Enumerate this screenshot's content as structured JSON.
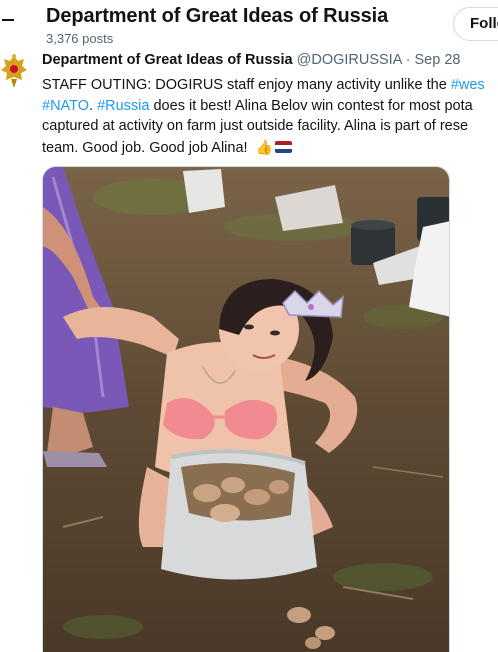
{
  "header": {
    "back_icon": "back-arrow-icon",
    "profile_name": "Department of Great Ideas of Russia",
    "post_count": "3,376 posts",
    "follow_label": "Follo"
  },
  "tweet": {
    "author": "Department of Great Ideas of Russia",
    "handle": "@DOGIRUSSIA",
    "separator": "·",
    "date": "Sep 28",
    "text": {
      "line1_prefix": "STAFF OUTING: DOGIRUS staff enjoy many activity unlike the ",
      "line1_hashtag": "#wes",
      "line2_hashtag1": "#NATO",
      "line2_mid": ". ",
      "line2_hashtag2": "#Russia",
      "line2_suffix": " does it best! Alina Belov win contest for most pota",
      "line3": "captured at activity on farm just outside facility. Alina is part of rese",
      "line4": "team. Good job. Good job Alina! "
    },
    "emoji": [
      "thumbs-up-icon",
      "netherlands-flag-icon"
    ],
    "media_description_icon": "photo-icon"
  },
  "colors": {
    "text": "#0f1419",
    "secondary": "#536471",
    "link": "#1d9bf0",
    "border": "#cfd9de"
  }
}
